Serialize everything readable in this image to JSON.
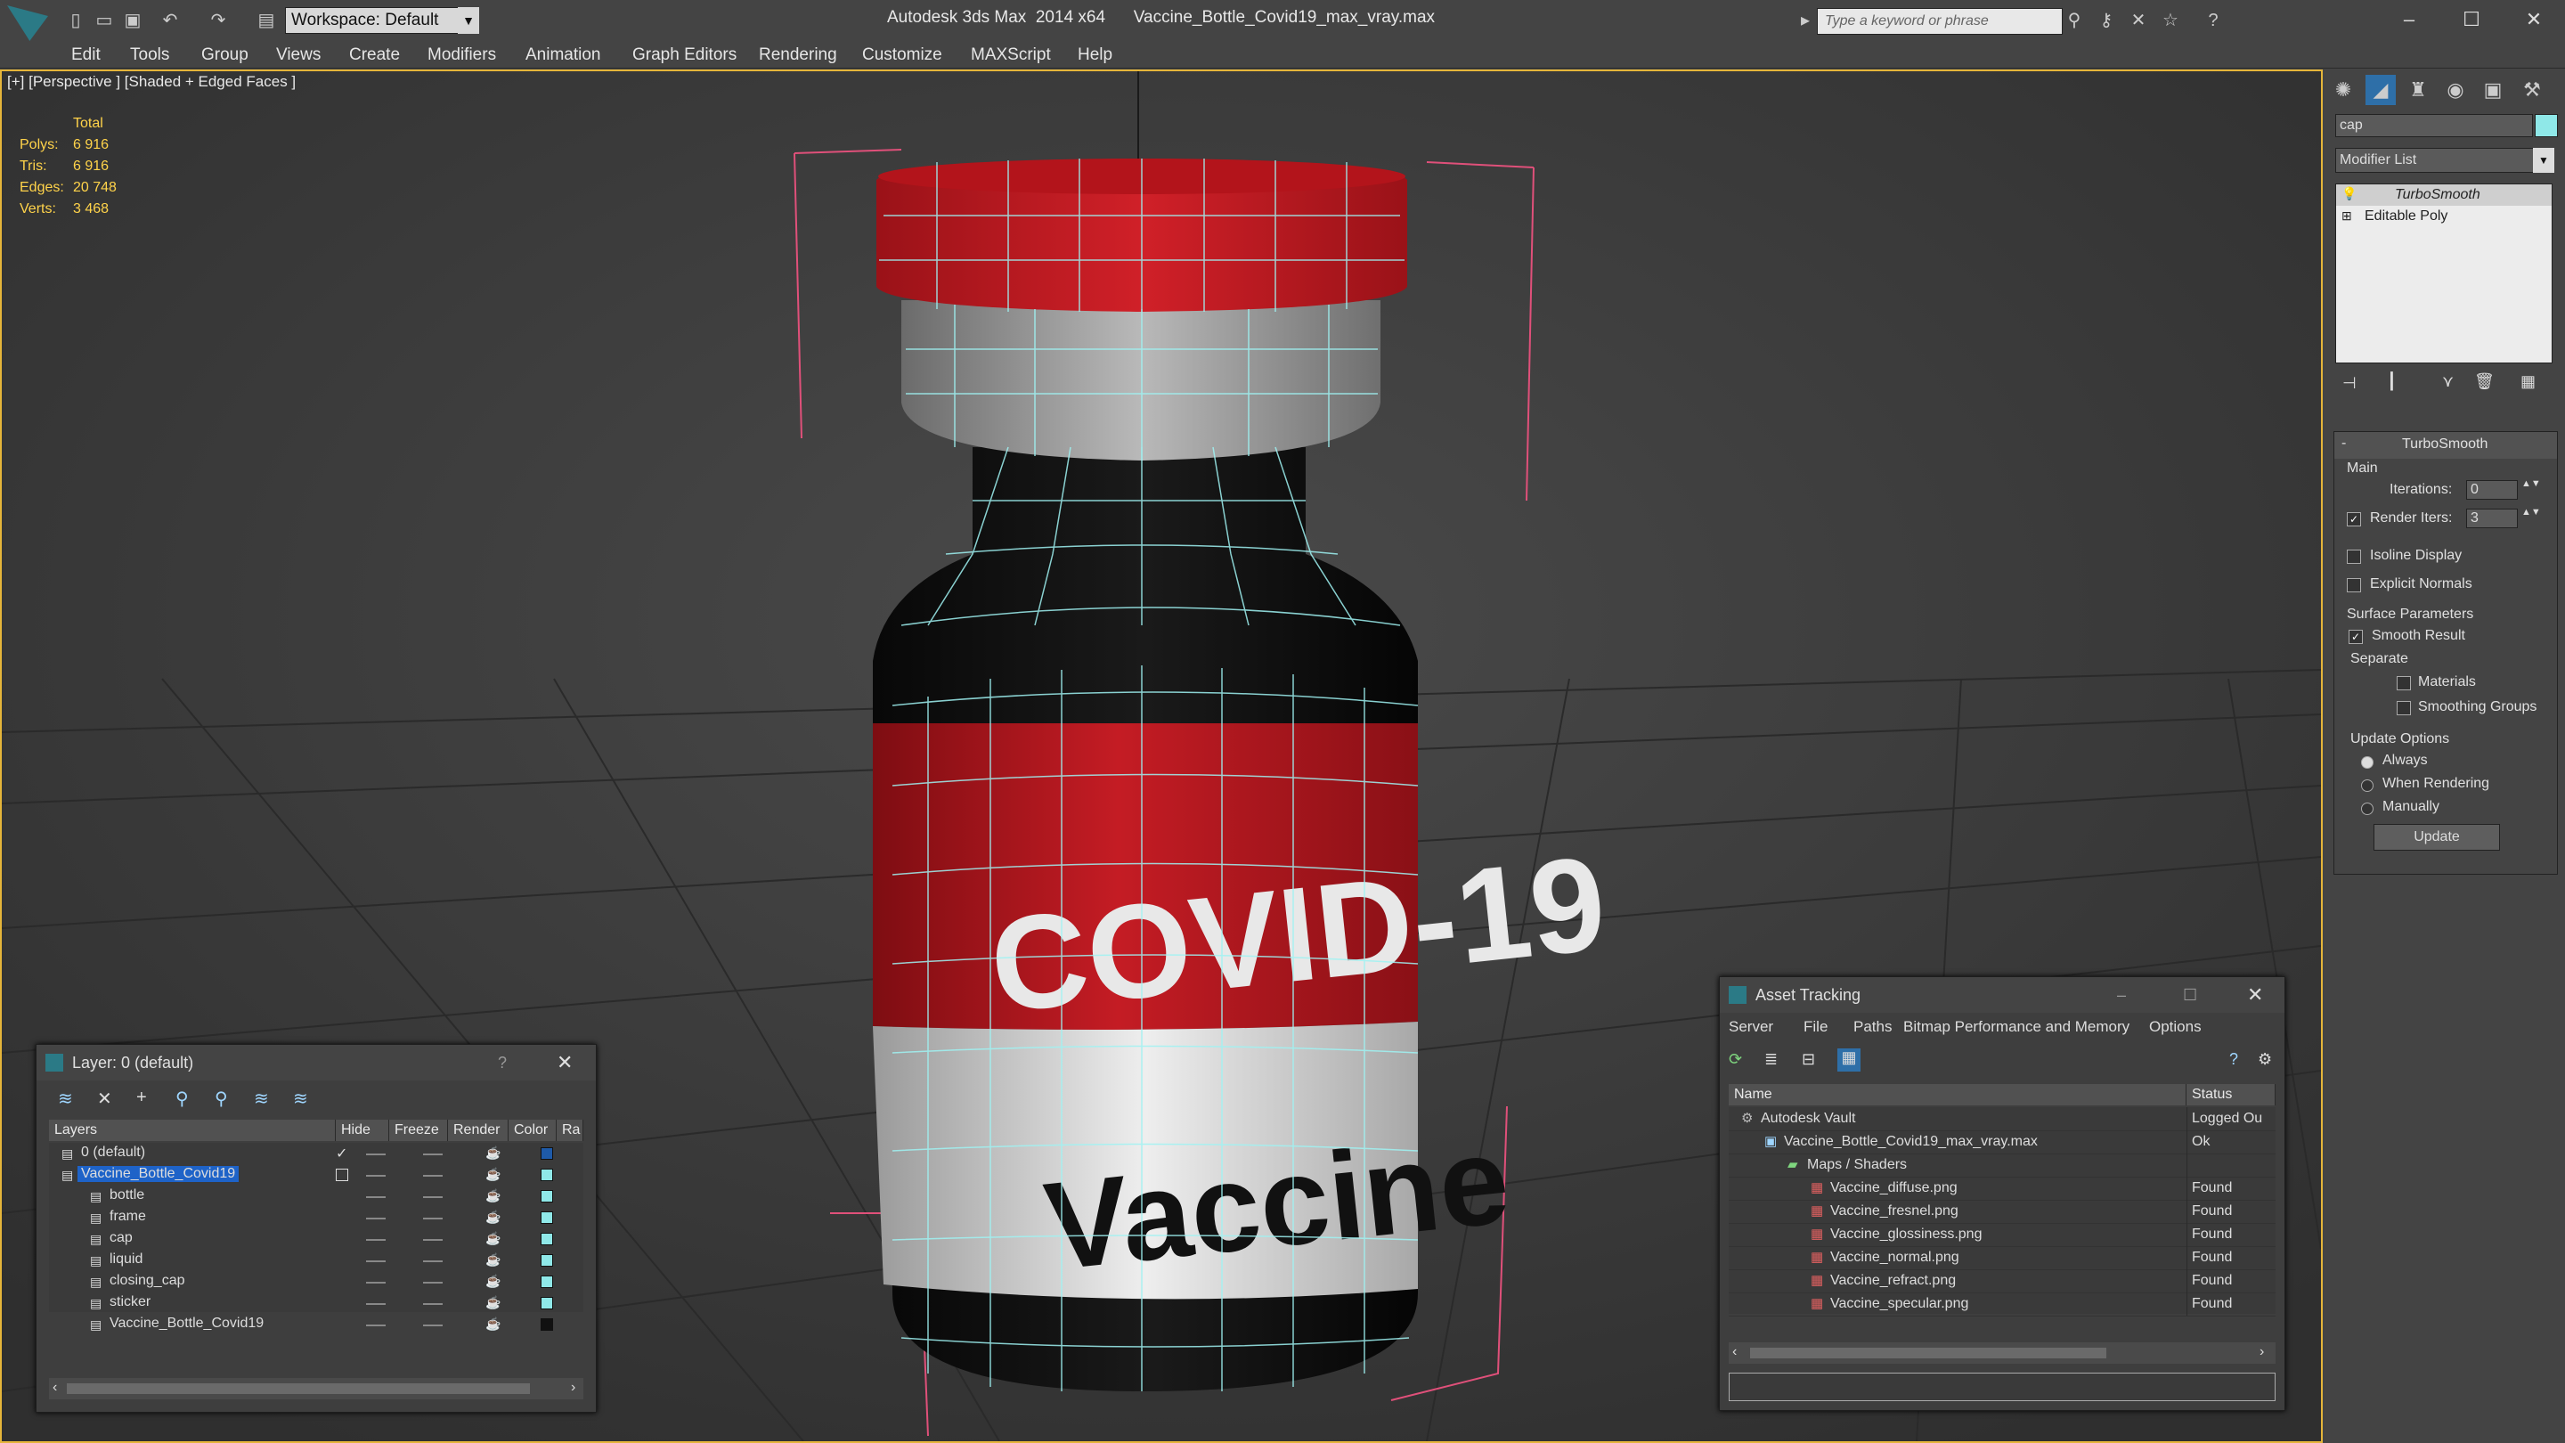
{
  "title": {
    "app": "Autodesk 3ds Max  2014 x64",
    "file": "Vaccine_Bottle_Covid19_max_vray.max",
    "workspace": "Workspace: Default",
    "search_placeholder": "Type a keyword or phrase"
  },
  "menu": [
    "Edit",
    "Tools",
    "Group",
    "Views",
    "Create",
    "Modifiers",
    "Animation",
    "Graph Editors",
    "Rendering",
    "Customize",
    "MAXScript",
    "Help"
  ],
  "viewport": {
    "label": "[+] [Perspective ] [Shaded + Edged Faces ]",
    "stats": {
      "header": "Total",
      "rows": [
        {
          "k": "Polys:",
          "v": "6 916"
        },
        {
          "k": "Tris:",
          "v": "6 916"
        },
        {
          "k": "Edges:",
          "v": "20 748"
        },
        {
          "k": "Verts:",
          "v": "3 468"
        }
      ]
    },
    "label_text_1": "COVID-19",
    "label_text_2": "Vaccine"
  },
  "command_panel": {
    "object_name": "cap",
    "modifier_list": "Modifier List",
    "stack": [
      "TurboSmooth",
      "Editable Poly"
    ],
    "rollout_title": "TurboSmooth",
    "main_group": "Main",
    "iterations_label": "Iterations:",
    "iterations_value": "0",
    "render_iters_label": "Render Iters:",
    "render_iters_value": "3",
    "isoline": "Isoline Display",
    "explicit": "Explicit Normals",
    "surface_group": "Surface Parameters",
    "smooth_result": "Smooth Result",
    "separate": "Separate",
    "materials": "Materials",
    "smoothing_groups": "Smoothing Groups",
    "update_group": "Update Options",
    "always": "Always",
    "when_rendering": "When Rendering",
    "manually": "Manually",
    "update_button": "Update"
  },
  "layer_window": {
    "title": "Layer: 0 (default)",
    "help": "?",
    "columns": [
      "Layers",
      "Hide",
      "Freeze",
      "Render",
      "Color",
      "Ra"
    ],
    "rows": [
      {
        "name": "0 (default)",
        "indent": 0,
        "color": "#1e5aa8",
        "check": true
      },
      {
        "name": "Vaccine_Bottle_Covid19",
        "indent": 0,
        "color": "#8fe8e8",
        "selected": true
      },
      {
        "name": "bottle",
        "indent": 1,
        "color": "#8fe8e8"
      },
      {
        "name": "frame",
        "indent": 1,
        "color": "#8fe8e8"
      },
      {
        "name": "cap",
        "indent": 1,
        "color": "#8fe8e8"
      },
      {
        "name": "liquid",
        "indent": 1,
        "color": "#8fe8e8"
      },
      {
        "name": "closing_cap",
        "indent": 1,
        "color": "#8fe8e8"
      },
      {
        "name": "sticker",
        "indent": 1,
        "color": "#8fe8e8"
      },
      {
        "name": "Vaccine_Bottle_Covid19",
        "indent": 1,
        "color": "#111111"
      }
    ]
  },
  "asset_window": {
    "title": "Asset Tracking",
    "menu": [
      "Server",
      "File",
      "Paths",
      "Bitmap Performance and Memory",
      "Options"
    ],
    "columns": [
      "Name",
      "Status"
    ],
    "rows": [
      {
        "name": "Autodesk Vault",
        "status": "Logged Ou",
        "indent": 0
      },
      {
        "name": "Vaccine_Bottle_Covid19_max_vray.max",
        "status": "Ok",
        "indent": 1
      },
      {
        "name": "Maps / Shaders",
        "status": "",
        "indent": 2
      },
      {
        "name": "Vaccine_diffuse.png",
        "status": "Found",
        "indent": 3
      },
      {
        "name": "Vaccine_fresnel.png",
        "status": "Found",
        "indent": 3
      },
      {
        "name": "Vaccine_glossiness.png",
        "status": "Found",
        "indent": 3
      },
      {
        "name": "Vaccine_normal.png",
        "status": "Found",
        "indent": 3
      },
      {
        "name": "Vaccine_refract.png",
        "status": "Found",
        "indent": 3
      },
      {
        "name": "Vaccine_specular.png",
        "status": "Found",
        "indent": 3
      }
    ]
  },
  "colors": {
    "accent_yellow": "#ffd34a",
    "selection_blue": "#1e63c8",
    "cap_red": "#c21a22",
    "wire_cyan": "#9ff3f3",
    "viewport_border": "#e5b53a"
  }
}
